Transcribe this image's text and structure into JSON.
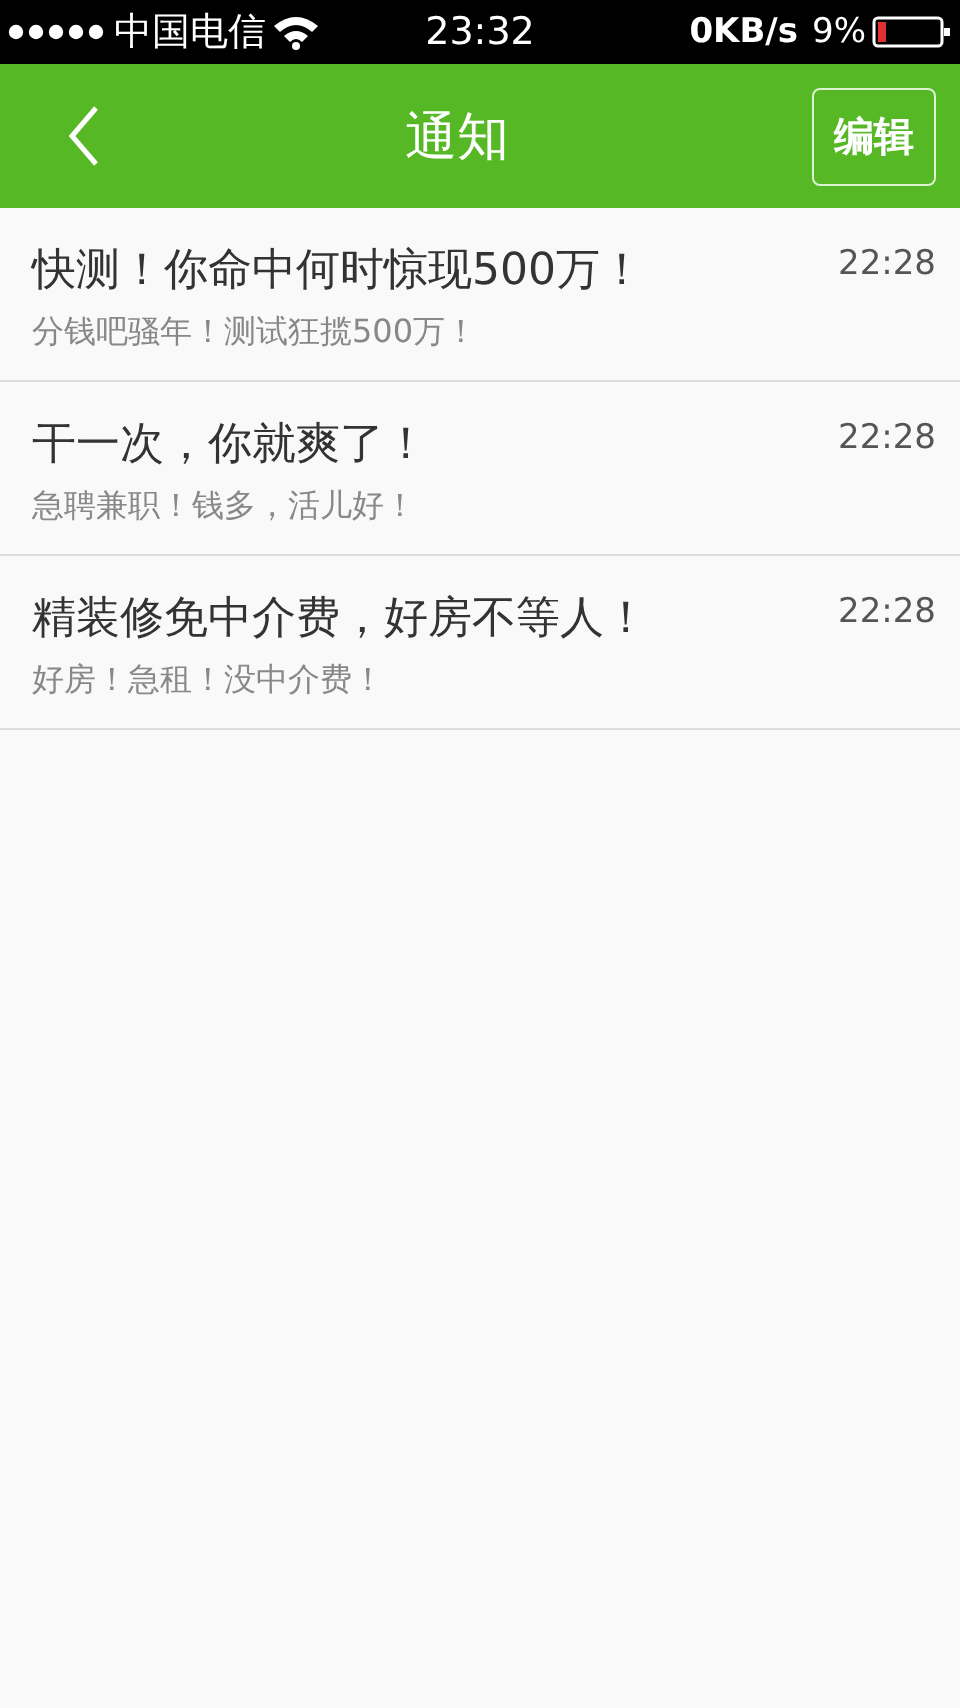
{
  "status_bar": {
    "carrier": "中国电信",
    "time": "23:32",
    "speed": "0KB/s",
    "battery": "9%"
  },
  "header": {
    "title": "通知",
    "edit_button": "编辑"
  },
  "notifications": [
    {
      "title": "快测！你命中何时惊现500万！",
      "summary": "分钱吧骚年！测试狂揽500万！",
      "time": "22:28"
    },
    {
      "title": "干一次，你就爽了！",
      "summary": "急聘兼职！钱多，活儿好！",
      "time": "22:28"
    },
    {
      "title": "精装修免中介费，好房不等人！",
      "summary": "好房！急租！没中介费！",
      "time": "22:28"
    }
  ]
}
